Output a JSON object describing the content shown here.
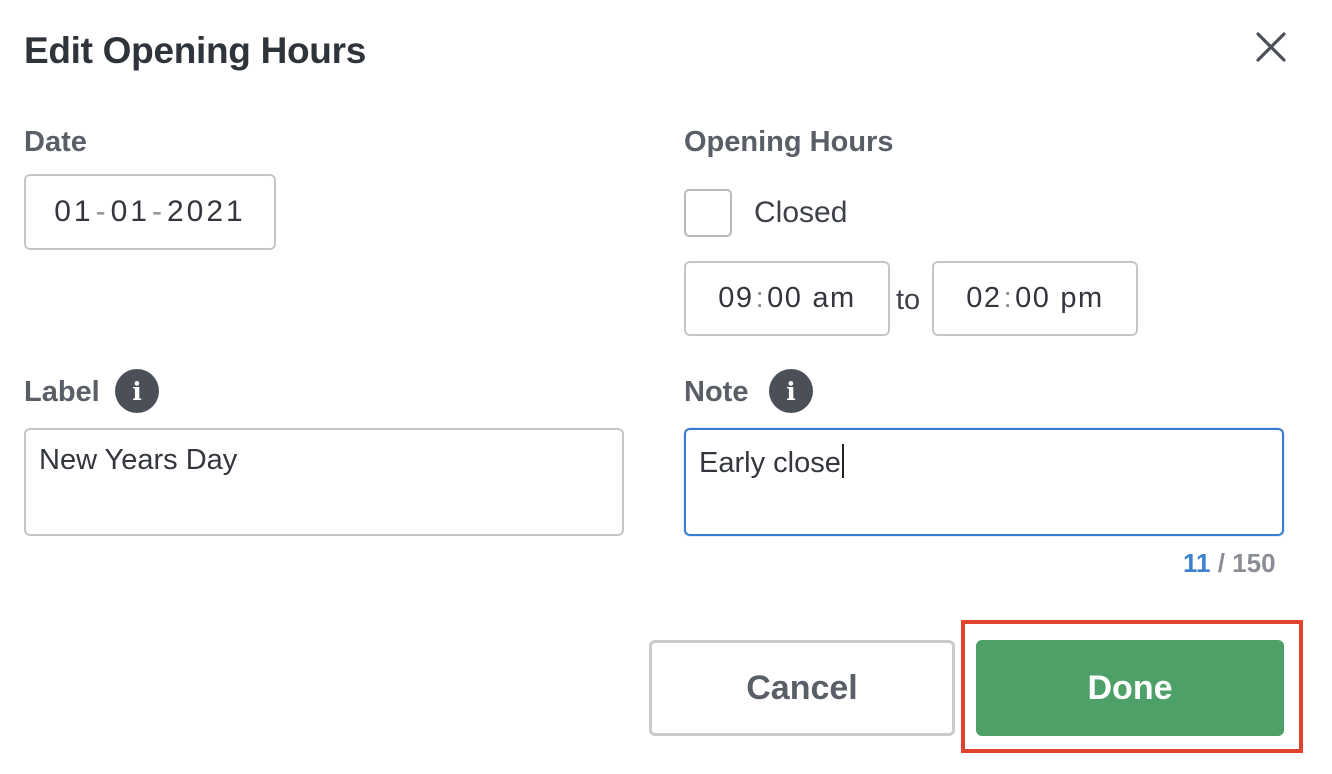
{
  "dialog": {
    "title": "Edit Opening Hours",
    "close_icon": "close-icon"
  },
  "date": {
    "label": "Date",
    "day": "01",
    "month": "01",
    "year": "2021",
    "separator": "-"
  },
  "opening_hours": {
    "label": "Opening Hours",
    "closed_label": "Closed",
    "closed_checked": false,
    "from": {
      "hour": "09",
      "minute": "00",
      "period": "am"
    },
    "to_label": "to",
    "to": {
      "hour": "02",
      "minute": "00",
      "period": "pm"
    },
    "time_separator": ":"
  },
  "label_field": {
    "label": "Label",
    "info_icon": "info-icon",
    "value": "New Years Day"
  },
  "note_field": {
    "label": "Note",
    "info_icon": "info-icon",
    "value": "Early close",
    "char_count": "11",
    "char_limit_text": " / 150"
  },
  "actions": {
    "cancel_label": "Cancel",
    "done_label": "Done"
  },
  "colors": {
    "done_button": "#4ca068",
    "highlight_border": "#e0422d",
    "focus_border": "#3a7bd5"
  }
}
